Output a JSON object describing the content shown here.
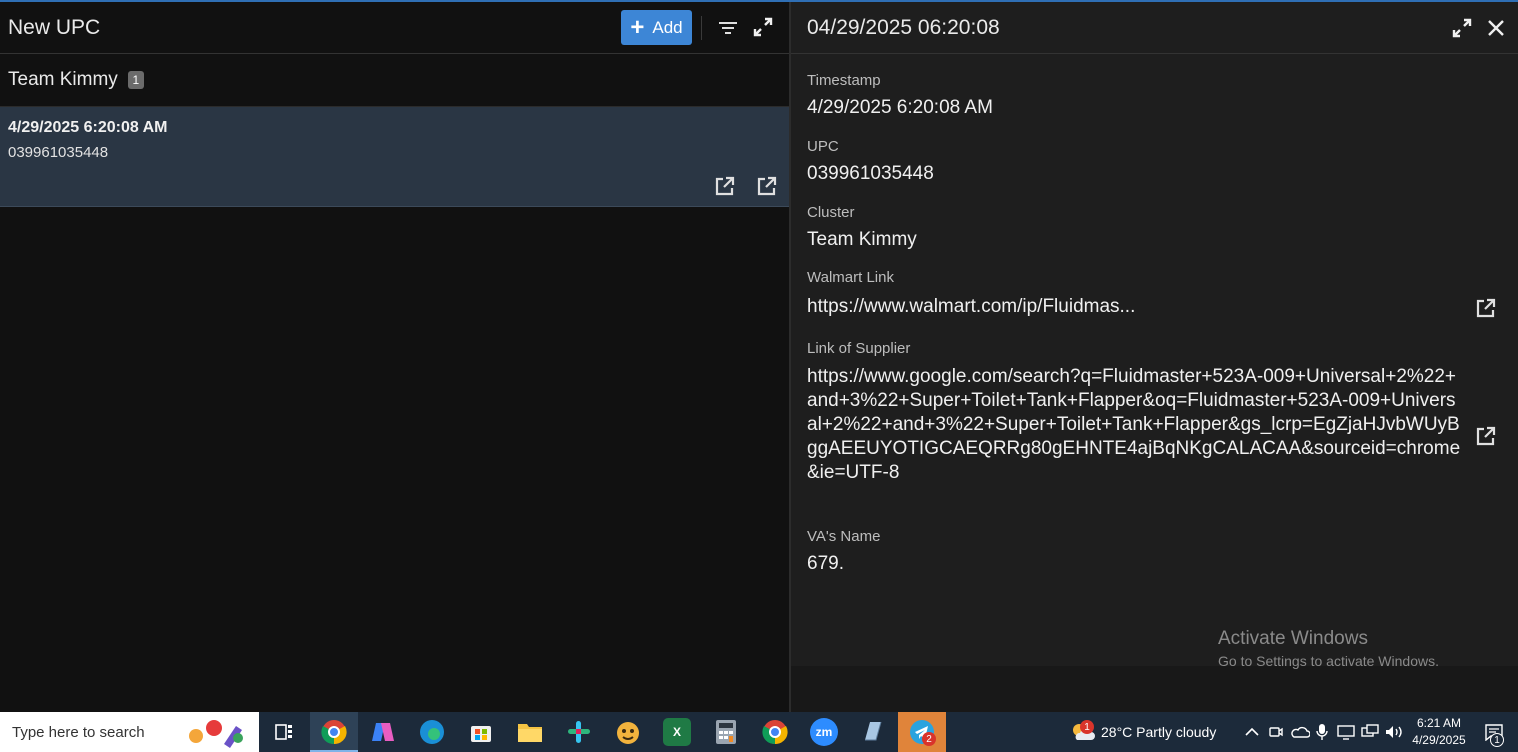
{
  "left_panel": {
    "title": "New UPC",
    "add_label": "Add",
    "group": {
      "name": "Team Kimmy",
      "count": "1"
    },
    "record": {
      "timestamp": "4/29/2025 6:20:08 AM",
      "upc": "039961035448"
    }
  },
  "detail": {
    "title": "04/29/2025 06:20:08",
    "fields": {
      "timestamp": {
        "label": "Timestamp",
        "value": "4/29/2025 6:20:08 AM"
      },
      "upc": {
        "label": "UPC",
        "value": "039961035448"
      },
      "cluster": {
        "label": "Cluster",
        "value": "Team Kimmy"
      },
      "walmart": {
        "label": "Walmart Link",
        "value": "https://www.walmart.com/ip/Fluidmas..."
      },
      "supplier": {
        "label": "Link of Supplier",
        "value": "https://www.google.com/search?q=Fluidmaster+523A-009+Universal+2%22+and+3%22+Super+Toilet+Tank+Flapper&oq=Fluidmaster+523A-009+Universal+2%22+and+3%22+Super+Toilet+Tank+Flapper&gs_lcrp=EgZjaHJvbWUyBggAEEUYOTIGCAEQRRg80gEHNTE4ajBqNKgCALACAA&sourceid=chrome&ie=UTF-8"
      },
      "va_name": {
        "label": "VA's Name",
        "value": "679."
      }
    }
  },
  "watermark": {
    "line1": "Activate Windows",
    "line2": "Go to Settings to activate Windows."
  },
  "taskbar": {
    "search_placeholder": "Type here to search",
    "weather": "28°C  Partly cloudy",
    "weather_badge": "1",
    "time": "6:21 AM",
    "date": "4/29/2025",
    "telegram_badge": "2",
    "notification_count": "1",
    "zoom_label": "zm"
  },
  "icons": [
    "plus-icon",
    "filter-icon",
    "expand-icon",
    "external-link-icon",
    "close-icon",
    "windows-taskbar-icons"
  ],
  "colors": {
    "accent": "#3d86d6",
    "selected_row": "#2a3644",
    "panel": "#1e1e1e",
    "taskbar": "#1c2a3a"
  }
}
